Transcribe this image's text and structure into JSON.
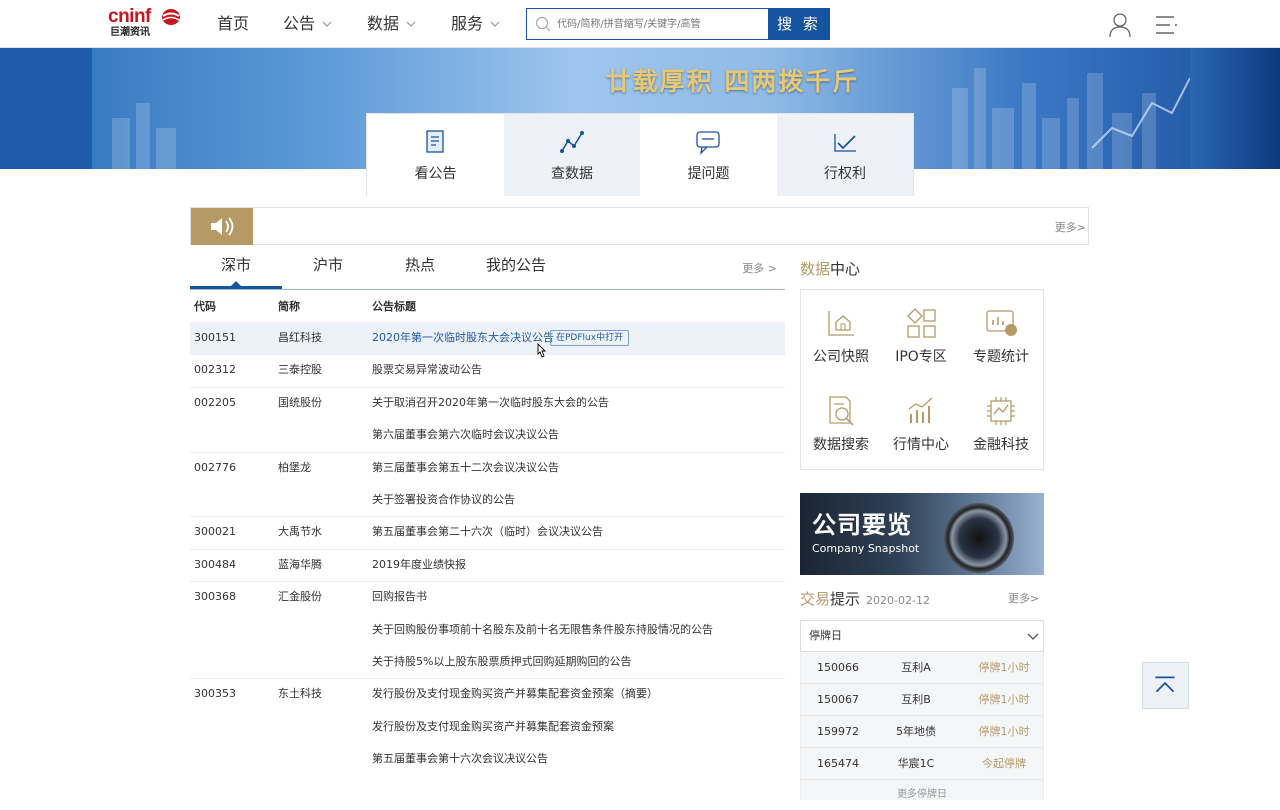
{
  "header": {
    "logo_top": "cninf",
    "logo_bottom": "巨潮资讯",
    "nav": [
      {
        "label": "首页",
        "has_dropdown": false
      },
      {
        "label": "公告",
        "has_dropdown": true
      },
      {
        "label": "数据",
        "has_dropdown": true
      },
      {
        "label": "服务",
        "has_dropdown": true
      }
    ],
    "search_placeholder": "代码/简称/拼音缩写/关键字/高管",
    "search_button": "搜 索"
  },
  "banner": {
    "slogan": "廿载厚积 四两拨千斤",
    "tiles": [
      {
        "label": "看公告",
        "icon": "document-icon"
      },
      {
        "label": "查数据",
        "icon": "line-chart-icon"
      },
      {
        "label": "提问题",
        "icon": "chat-icon"
      },
      {
        "label": "行权利",
        "icon": "check-chart-icon"
      }
    ]
  },
  "notice": {
    "more": "更多>"
  },
  "announcements": {
    "tabs": [
      "深市",
      "沪市",
      "热点",
      "我的公告"
    ],
    "active_tab": "深市",
    "more": "更多 >",
    "headers": [
      "代码",
      "简称",
      "公告标题"
    ],
    "pdf_tag": "在PDFlux中打开",
    "rows": [
      {
        "code": "300151",
        "name": "昌红科技",
        "title": "2020年第一次临时股东大会决议公告",
        "highlight": true
      },
      {
        "code": "002312",
        "name": "三泰控股",
        "title": "股票交易异常波动公告"
      },
      {
        "code": "002205",
        "name": "国统股份",
        "title": "关于取消召开2020年第一次临时股东大会的公告"
      },
      {
        "code": "",
        "name": "",
        "title": "第六届董事会第六次临时会议决议公告"
      },
      {
        "code": "002776",
        "name": "柏堡龙",
        "title": "第三届董事会第五十二次会议决议公告"
      },
      {
        "code": "",
        "name": "",
        "title": "关于签署投资合作协议的公告"
      },
      {
        "code": "300021",
        "name": "大禹节水",
        "title": "第五届董事会第二十六次（临时）会议决议公告"
      },
      {
        "code": "300484",
        "name": "蓝海华腾",
        "title": "2019年度业绩快报"
      },
      {
        "code": "300368",
        "name": "汇金股份",
        "title": "回购报告书"
      },
      {
        "code": "",
        "name": "",
        "title": "关于回购股份事项前十名股东及前十名无限售条件股东持股情况的公告"
      },
      {
        "code": "",
        "name": "",
        "title": "关于持股5%以上股东股票质押式回购延期购回的公告"
      },
      {
        "code": "300353",
        "name": "东土科技",
        "title": "发行股份及支付现金购买资产并募集配套资金预案（摘要）"
      },
      {
        "code": "",
        "name": "",
        "title": "发行股份及支付现金购买资产并募集配套资金预案"
      },
      {
        "code": "",
        "name": "",
        "title": "第五届董事会第十六次会议决议公告"
      }
    ]
  },
  "data_center": {
    "title_gold": "数据",
    "title_rest": "中心",
    "items": [
      {
        "label": "公司快照",
        "icon": "house-chart-icon"
      },
      {
        "label": "IPO专区",
        "icon": "grid-icon"
      },
      {
        "label": "专题统计",
        "icon": "stats-board-icon"
      },
      {
        "label": "数据搜索",
        "icon": "doc-search-icon"
      },
      {
        "label": "行情中心",
        "icon": "bar-trend-icon"
      },
      {
        "label": "金融科技",
        "icon": "chip-icon"
      }
    ]
  },
  "ad": {
    "title": "公司要览",
    "subtitle": "Company Snapshot"
  },
  "trade": {
    "title_gold": "交易",
    "title_rest": "提示",
    "date": "2020-02-12",
    "more": "更多>",
    "select": "停牌日",
    "rows": [
      {
        "code": "150066",
        "name": "互利A",
        "status": "停牌1小时"
      },
      {
        "code": "150067",
        "name": "互利B",
        "status": "停牌1小时"
      },
      {
        "code": "159972",
        "name": "5年地债",
        "status": "停牌1小时"
      },
      {
        "code": "165474",
        "name": "华宸1C",
        "status": "今起停牌"
      }
    ],
    "more_stop": "更多停牌日"
  },
  "colors": {
    "brand_blue": "#1654a0",
    "gold": "#b59a66",
    "logo_red": "#c8161d"
  }
}
